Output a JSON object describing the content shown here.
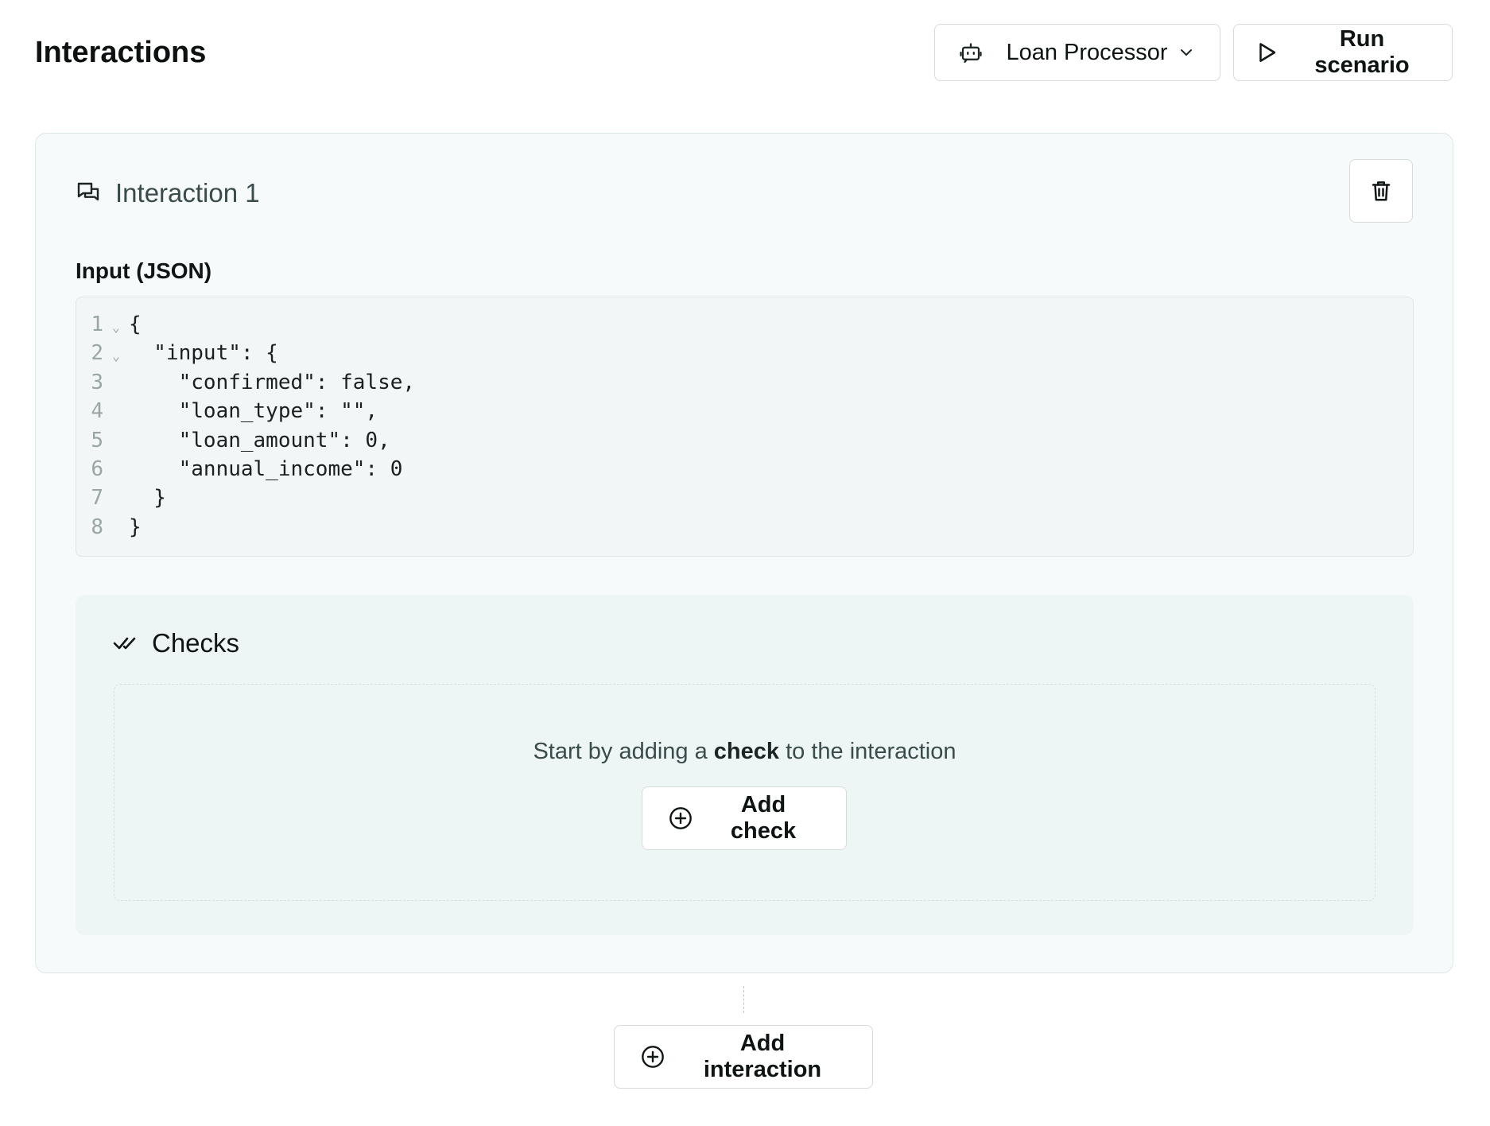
{
  "header": {
    "title": "Interactions",
    "agent_select": {
      "value": "Loan Processor",
      "icon": "robot-icon"
    },
    "run_button": {
      "label": "Run scenario",
      "icon": "play-icon"
    }
  },
  "interaction": {
    "title": "Interaction 1",
    "icon": "chat-bubbles-icon",
    "delete_icon": "trash-icon",
    "input_label": "Input (JSON)",
    "code_lines": [
      {
        "num": "1",
        "text": "{",
        "foldable": true
      },
      {
        "num": "2",
        "text": "  \"input\": {",
        "foldable": true
      },
      {
        "num": "3",
        "text": "    \"confirmed\": false,",
        "foldable": false
      },
      {
        "num": "4",
        "text": "    \"loan_type\": \"\",",
        "foldable": false
      },
      {
        "num": "5",
        "text": "    \"loan_amount\": 0,",
        "foldable": false
      },
      {
        "num": "6",
        "text": "    \"annual_income\": 0",
        "foldable": false
      },
      {
        "num": "7",
        "text": "  }",
        "foldable": false
      },
      {
        "num": "8",
        "text": "}",
        "foldable": false
      }
    ],
    "checks": {
      "title": "Checks",
      "icon": "double-check-icon",
      "empty_prefix": "Start by adding a ",
      "empty_emphasis": "check",
      "empty_suffix": " to the interaction",
      "add_check_label": "Add check"
    }
  },
  "add_interaction_label": "Add interaction",
  "colors": {
    "card_background": "#f6fafa",
    "checks_background": "#eef6f5",
    "code_background": "#f2f6f6",
    "border": "#d5dcdb",
    "muted_text": "#3a4b4b"
  }
}
